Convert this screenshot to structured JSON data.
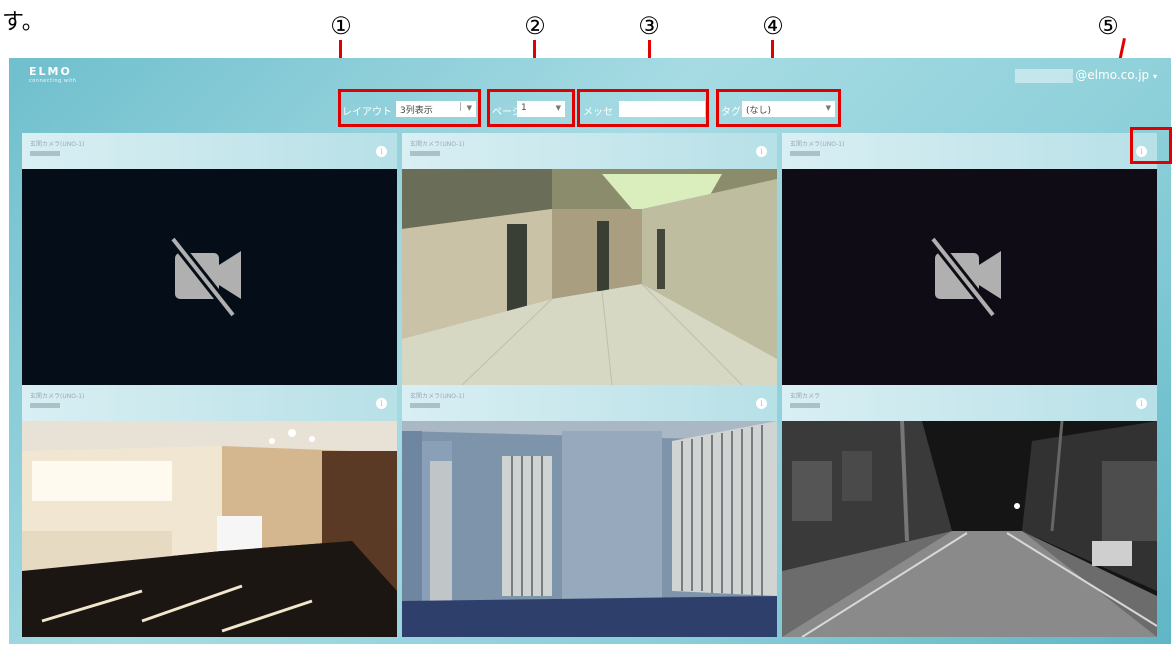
{
  "document": {
    "text": "す。"
  },
  "callouts": [
    "①",
    "②",
    "③",
    "④",
    "⑤"
  ],
  "app": {
    "logo_main": "ELMO",
    "logo_sub": "connecting with",
    "user_suffix": "@elmo.co.jp",
    "user_caret": "▾",
    "toolbar": {
      "layout_label": "レイアウト",
      "layout_value": "3列表示",
      "page_label": "ページ",
      "page_value": "1",
      "memo_label": "メッセ",
      "memo_value": "",
      "tag_label": "タグ",
      "tag_value": "(なし)"
    },
    "tiles": [
      {
        "camera_name": "玄関カメラ(UNO-1)",
        "state": "no-signal"
      },
      {
        "camera_name": "玄関カメラ(UNO-1)",
        "state": "corridor"
      },
      {
        "camera_name": "玄関カメラ(UNO-1)",
        "state": "no-signal"
      },
      {
        "camera_name": "玄関カメラ(UNO-1)",
        "state": "lobby"
      },
      {
        "camera_name": "玄関カメラ(UNO-1)",
        "state": "elevators"
      },
      {
        "camera_name": "玄関カメラ",
        "state": "street"
      }
    ],
    "info_icon": "i"
  },
  "colors": {
    "callout": "#e00000",
    "app_bg": "#8ccfd9",
    "no_signal_bg_1": "#050d18",
    "no_signal_bg_2": "#100c16"
  },
  "icons": [
    "camera-off-icon",
    "info-icon",
    "chevron-down-icon"
  ]
}
